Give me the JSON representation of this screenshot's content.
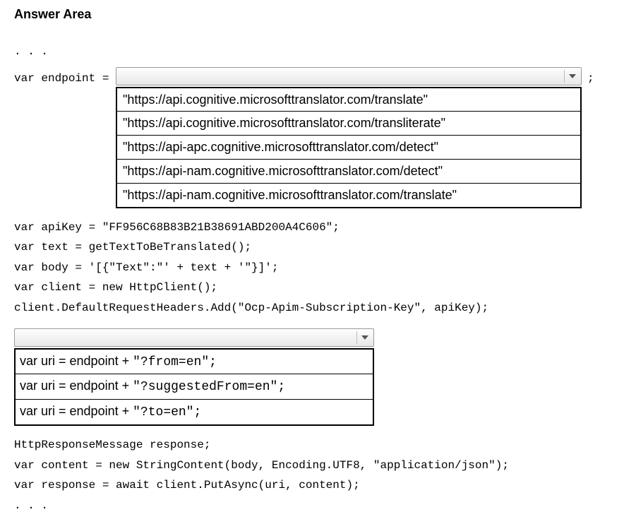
{
  "title": "Answer Area",
  "code": {
    "line0": ". . .",
    "line1_prefix": "var endpoint = ",
    "line1_suffix": ";",
    "dropdown1_options": [
      "\"https://api.cognitive.microsofttranslator.com/translate\"",
      "\"https://api.cognitive.microsofttranslator.com/transliterate\"",
      "\"https://api-apc.cognitive.microsofttranslator.com/detect\"",
      "\"https://api-nam.cognitive.microsofttranslator.com/detect\"",
      "\"https://api-nam.cognitive.microsofttranslator.com/translate\""
    ],
    "line2": "var apiKey = \"FF956C68B83B21B38691ABD200A4C606\";",
    "line3": "var text = getTextToBeTranslated();",
    "line4": "var body = '[{\"Text\":\"' + text + '\"}]';",
    "line5": "var client = new HttpClient();",
    "line6": "client.DefaultRequestHeaders.Add(\"Ocp-Apim-Subscription-Key\", apiKey);",
    "dropdown2_options": [
      {
        "prefix": "var uri = endpoint + ",
        "code": "\"?from=en\";"
      },
      {
        "prefix": "var uri = endpoint + ",
        "code": "\"?suggestedFrom=en\";"
      },
      {
        "prefix": "var uri = endpoint + ",
        "code": "\"?to=en\";"
      }
    ],
    "line7": "HttpResponseMessage response;",
    "line8": "var content = new StringContent(body, Encoding.UTF8, \"application/json\");",
    "line9": "var response = await client.PutAsync(uri, content);",
    "line10": ". . ."
  }
}
